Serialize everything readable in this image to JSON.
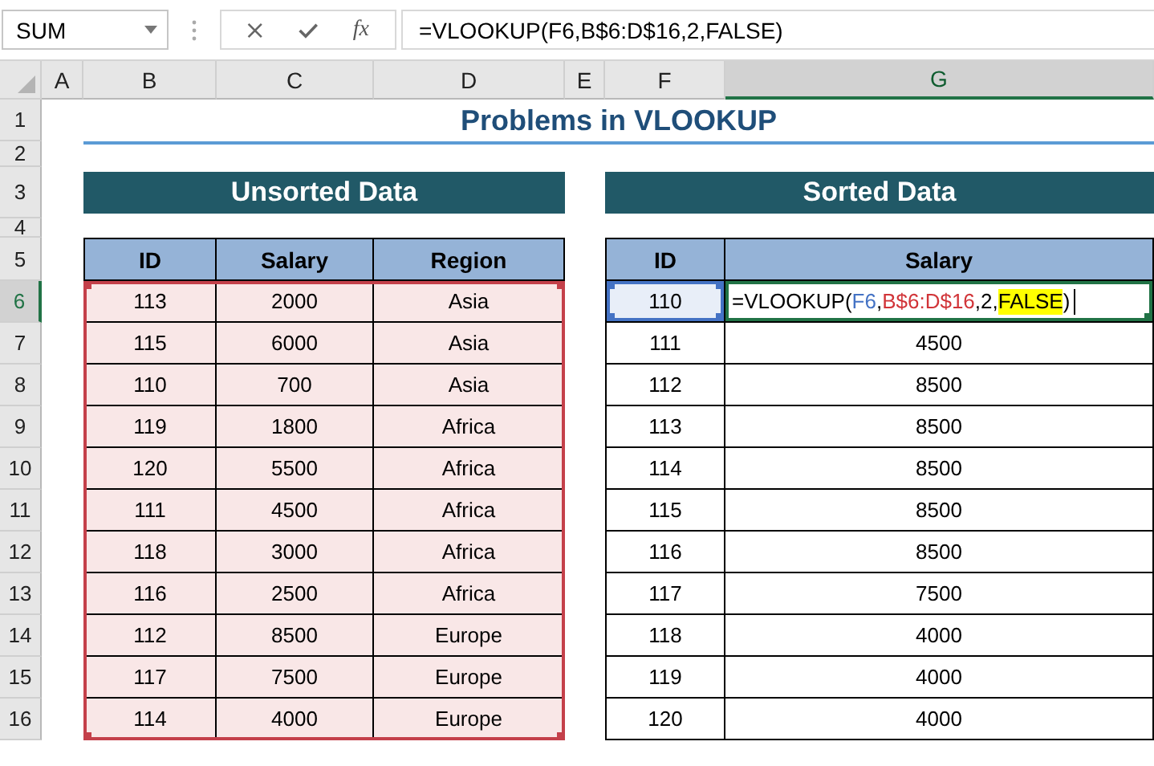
{
  "name_box": "SUM",
  "function_label": "fx",
  "formula": "=VLOOKUP(F6,B$6:D$16,2,FALSE)",
  "columns": [
    {
      "label": "A",
      "selected": false
    },
    {
      "label": "B",
      "selected": false
    },
    {
      "label": "C",
      "selected": false
    },
    {
      "label": "D",
      "selected": false
    },
    {
      "label": "E",
      "selected": false
    },
    {
      "label": "F",
      "selected": false
    },
    {
      "label": "G",
      "selected": true
    }
  ],
  "rows": [
    {
      "label": "1",
      "selected": false
    },
    {
      "label": "2",
      "selected": false
    },
    {
      "label": "3",
      "selected": false
    },
    {
      "label": "4",
      "selected": false
    },
    {
      "label": "5",
      "selected": false
    },
    {
      "label": "6",
      "selected": true
    },
    {
      "label": "7",
      "selected": false
    },
    {
      "label": "8",
      "selected": false
    },
    {
      "label": "9",
      "selected": false
    },
    {
      "label": "10",
      "selected": false
    },
    {
      "label": "11",
      "selected": false
    },
    {
      "label": "12",
      "selected": false
    },
    {
      "label": "13",
      "selected": false
    },
    {
      "label": "14",
      "selected": false
    },
    {
      "label": "15",
      "selected": false
    },
    {
      "label": "16",
      "selected": false
    }
  ],
  "title": "Problems in VLOOKUP",
  "unsorted": {
    "heading": "Unsorted Data",
    "referenced": true,
    "columns": [
      "ID",
      "Salary",
      "Region"
    ],
    "rows": [
      [
        "113",
        "2000",
        "Asia"
      ],
      [
        "115",
        "6000",
        "Asia"
      ],
      [
        "110",
        "700",
        "Asia"
      ],
      [
        "119",
        "1800",
        "Africa"
      ],
      [
        "120",
        "5500",
        "Africa"
      ],
      [
        "111",
        "4500",
        "Africa"
      ],
      [
        "118",
        "3000",
        "Africa"
      ],
      [
        "116",
        "2500",
        "Africa"
      ],
      [
        "112",
        "8500",
        "Europe"
      ],
      [
        "117",
        "7500",
        "Europe"
      ],
      [
        "114",
        "4000",
        "Europe"
      ]
    ]
  },
  "sorted": {
    "heading": "Sorted Data",
    "columns": [
      "ID",
      "Salary"
    ],
    "rows": [
      {
        "id": "110",
        "referenced": true,
        "editing": true,
        "formula_segments": [
          {
            "text": "=VLOOKUP(",
            "kind": "plain",
            "highlighted": false
          },
          {
            "text": "F6",
            "kind": "lookup_ref",
            "highlighted": false,
            "after": ","
          },
          {
            "text": "B$6:D$16",
            "kind": "range_ref",
            "highlighted": false
          },
          {
            "text": ",2,",
            "kind": "plain",
            "highlighted": false
          },
          {
            "text": "FALSE",
            "kind": "plain",
            "highlighted": true
          },
          {
            "text": ")",
            "kind": "plain",
            "highlighted": false
          }
        ]
      },
      {
        "id": "111",
        "salary": "4500"
      },
      {
        "id": "112",
        "salary": "8500"
      },
      {
        "id": "113",
        "salary": "8500"
      },
      {
        "id": "114",
        "salary": "8500"
      },
      {
        "id": "115",
        "salary": "8500"
      },
      {
        "id": "116",
        "salary": "8500"
      },
      {
        "id": "117",
        "salary": "7500"
      },
      {
        "id": "118",
        "salary": "4000"
      },
      {
        "id": "119",
        "salary": "4000"
      },
      {
        "id": "120",
        "salary": "4000"
      }
    ]
  }
}
